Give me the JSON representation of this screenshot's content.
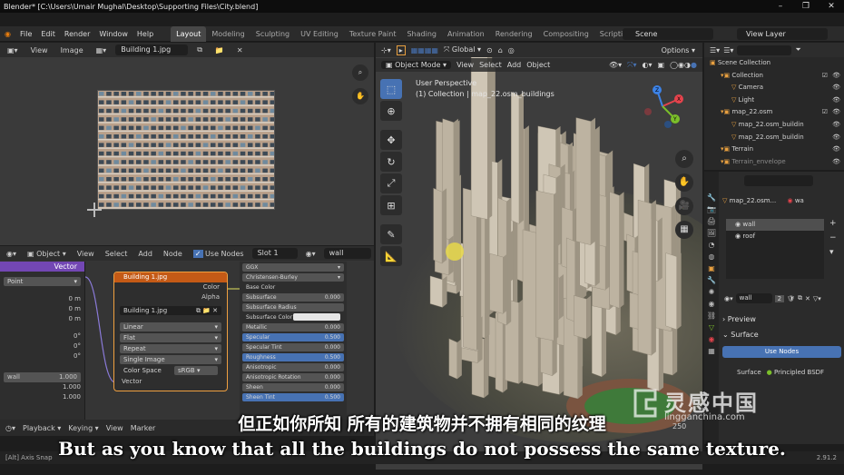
{
  "window": {
    "title": "Blender* [C:\\Users\\Umair Mughal\\Desktop\\Supporting Files\\City.blend]",
    "controls": [
      "–",
      "❐",
      "✕"
    ]
  },
  "topbar": {
    "menus": [
      "File",
      "Edit",
      "Render",
      "Window",
      "Help"
    ],
    "workspaces": [
      "Layout",
      "Modeling",
      "Sculpting",
      "UV Editing",
      "Texture Paint",
      "Shading",
      "Animation",
      "Rendering",
      "Compositing",
      "Scripting"
    ],
    "active_workspace": "Layout",
    "scene": "Scene",
    "view_layer": "View Layer"
  },
  "image_editor": {
    "menus": [
      "View",
      "Image"
    ],
    "image_name": "Building 1.jpg"
  },
  "viewport": {
    "mode": "Object Mode",
    "menus": [
      "View",
      "Select",
      "Add",
      "Object"
    ],
    "transform_orientation": "Global",
    "options_label": "Options",
    "perspective_label": "User Perspective",
    "collection_label": "(1) Collection | map_22.osm_buildings",
    "gizmo_axes": [
      "X",
      "Y",
      "Z"
    ],
    "axis_colors": {
      "x": "#e5434c",
      "y": "#7bbf2a",
      "z": "#3c82e6"
    }
  },
  "node_editor": {
    "menus": [
      "Object",
      "View",
      "Select",
      "Add",
      "Node"
    ],
    "use_nodes_label": "Use Nodes",
    "slot": "Slot 1",
    "material": "wall",
    "left_node": {
      "header": "Vector",
      "point_label": "Point",
      "rows": [
        {
          "label": "",
          "value": "0 m"
        },
        {
          "label": "",
          "value": "0 m"
        },
        {
          "label": "",
          "value": "0 m"
        },
        {
          "label": "",
          "value": "0°"
        },
        {
          "label": "",
          "value": "0°"
        },
        {
          "label": "",
          "value": "0°"
        }
      ],
      "bottom_rows": [
        {
          "label": "wall",
          "value": "1.000"
        },
        {
          "label": "",
          "value": "1.000"
        },
        {
          "label": "",
          "value": "1.000"
        }
      ]
    },
    "image_node": {
      "title": "Building 1.jpg",
      "outputs": [
        "Color",
        "Alpha"
      ],
      "image_field": "Building 1.jpg",
      "interpolation": "Linear",
      "projection": "Flat",
      "extension": "Repeat",
      "source": "Single Image",
      "color_space_label": "Color Space",
      "color_space": "sRGB",
      "input": "Vector"
    },
    "bsdf_node": {
      "distribution": "GGX",
      "subsurface_method": "Christensen-Burley",
      "base_color_label": "Base Color",
      "rows": [
        {
          "label": "Subsurface",
          "value": "0.000",
          "style": "grey"
        },
        {
          "label": "Subsurface Radius",
          "value": "",
          "style": "grey"
        },
        {
          "label": "Subsurface Color",
          "value": "",
          "style": "label"
        },
        {
          "label": "Metallic",
          "value": "0.000",
          "style": "grey"
        },
        {
          "label": "Specular",
          "value": "0.500",
          "style": "blue"
        },
        {
          "label": "Specular Tint",
          "value": "0.000",
          "style": "grey"
        },
        {
          "label": "Roughness",
          "value": "0.500",
          "style": "blue"
        },
        {
          "label": "Anisotropic",
          "value": "0.000",
          "style": "grey"
        },
        {
          "label": "Anisotropic Rotation",
          "value": "0.000",
          "style": "grey"
        },
        {
          "label": "Sheen",
          "value": "0.000",
          "style": "grey"
        },
        {
          "label": "Sheen Tint",
          "value": "0.500",
          "style": "blue"
        }
      ]
    }
  },
  "outliner": {
    "items": [
      {
        "label": "Scene Collection",
        "indent": 0,
        "check": false,
        "eye": false,
        "dim": false
      },
      {
        "label": "Collection",
        "indent": 1,
        "check": true,
        "eye": true,
        "dim": false
      },
      {
        "label": "Camera",
        "indent": 2,
        "check": false,
        "eye": true,
        "dim": false
      },
      {
        "label": "Light",
        "indent": 2,
        "check": false,
        "eye": true,
        "dim": false
      },
      {
        "label": "map_22.osm",
        "indent": 1,
        "check": true,
        "eye": true,
        "dim": false
      },
      {
        "label": "map_22.osm_buildin",
        "indent": 2,
        "check": false,
        "eye": true,
        "dim": false
      },
      {
        "label": "map_22.osm_buildin",
        "indent": 2,
        "check": false,
        "eye": true,
        "dim": false
      },
      {
        "label": "Terrain",
        "indent": 1,
        "check": false,
        "eye": true,
        "dim": false
      },
      {
        "label": "Terrain_envelope",
        "indent": 1,
        "check": false,
        "eye": true,
        "dim": true
      }
    ]
  },
  "properties": {
    "object_name": "map_22.osm...",
    "object_name_right": "wa",
    "materials": [
      "wall",
      "roof"
    ],
    "selected_material": "wall",
    "material_field": "wall",
    "user_count": "2",
    "preview_label": "Preview",
    "surface_label": "Surface",
    "use_nodes_label": "Use Nodes",
    "surface_field_label": "Surface",
    "surface_shader": "Principled BSDF"
  },
  "timeline": {
    "menus": [
      "Playback",
      "Keying",
      "View",
      "Marker"
    ],
    "frame": "250"
  },
  "statusbar": {
    "left": "Axis Snap",
    "version": "2.91.2"
  },
  "subtitles": {
    "chinese": "但正如你所知 所有的建筑物并不拥有相同的纹理",
    "english": "But as you know that all the buildings do not possess the same texture."
  },
  "watermark": {
    "text_cn": "灵感中国",
    "text_en": "lingganchina.com"
  }
}
